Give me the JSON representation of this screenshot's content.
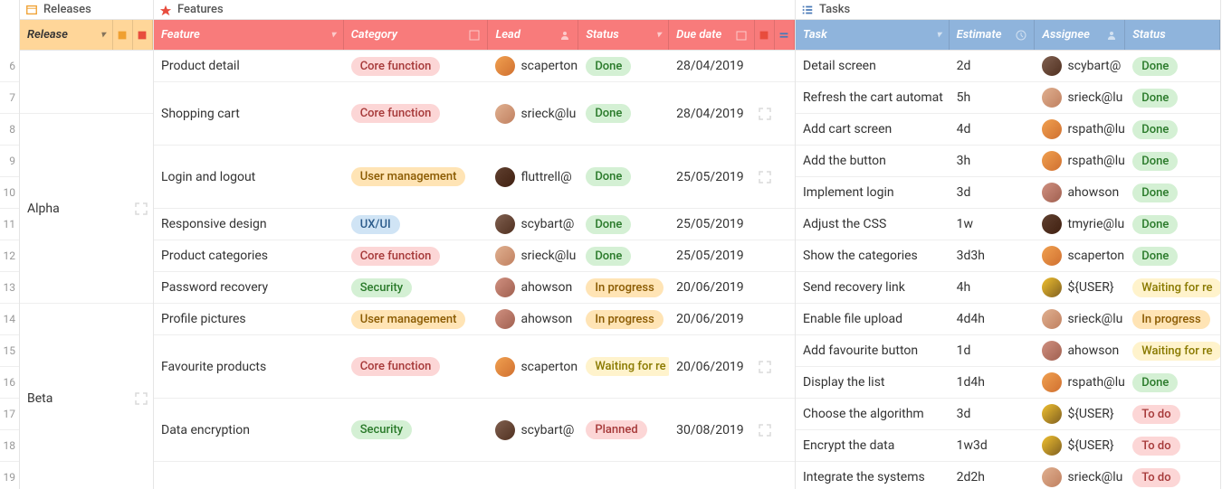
{
  "panels": {
    "releases": {
      "title": "Releases",
      "header": "Release"
    },
    "features": {
      "title": "Features",
      "headers": {
        "feature": "Feature",
        "category": "Category",
        "lead": "Lead",
        "status": "Status",
        "due": "Due date"
      }
    },
    "tasks": {
      "title": "Tasks",
      "headers": {
        "task": "Task",
        "estimate": "Estimate",
        "assignee": "Assignee",
        "status": "Status"
      }
    }
  },
  "row_numbers": [
    "6",
    "7",
    "8",
    "9",
    "10",
    "11",
    "12",
    "13",
    "14",
    "15",
    "16",
    "17",
    "18",
    "19"
  ],
  "releases": [
    {
      "name": "",
      "span": "h2"
    },
    {
      "name": "Alpha",
      "span": "h6"
    },
    {
      "name": "Beta",
      "span": "h6"
    }
  ],
  "features": [
    {
      "name": "Product detail",
      "category": "Core function",
      "cat_class": "badge-core",
      "lead": "scaperton",
      "av": "av1",
      "status": "Done",
      "st_class": "badge-done",
      "due": "28/04/2019",
      "span": ""
    },
    {
      "name": "Shopping cart",
      "category": "Core function",
      "cat_class": "badge-core",
      "lead": "srieck@lu",
      "av": "av2",
      "status": "Done",
      "st_class": "badge-done",
      "due": "28/04/2019",
      "span": "h2"
    },
    {
      "name": "Login and logout",
      "category": "User management",
      "cat_class": "badge-usermgmt",
      "lead": "fluttrell@",
      "av": "av3",
      "status": "Done",
      "st_class": "badge-done",
      "due": "25/05/2019",
      "span": "h2"
    },
    {
      "name": "Responsive design",
      "category": "UX/UI",
      "cat_class": "badge-uxui",
      "lead": "scybart@",
      "av": "av4",
      "status": "Done",
      "st_class": "badge-done",
      "due": "25/05/2019",
      "span": ""
    },
    {
      "name": "Product categories",
      "category": "Core function",
      "cat_class": "badge-core",
      "lead": "srieck@lu",
      "av": "av2",
      "status": "Done",
      "st_class": "badge-done",
      "due": "25/05/2019",
      "span": ""
    },
    {
      "name": "Password recovery",
      "category": "Security",
      "cat_class": "badge-security",
      "lead": "ahowson",
      "av": "av5",
      "status": "In progress",
      "st_class": "badge-inprogress",
      "due": "20/06/2019",
      "span": ""
    },
    {
      "name": "Profile pictures",
      "category": "User management",
      "cat_class": "badge-usermgmt",
      "lead": "ahowson",
      "av": "av5",
      "status": "In progress",
      "st_class": "badge-inprogress",
      "due": "20/06/2019",
      "span": ""
    },
    {
      "name": "Favourite products",
      "category": "Core function",
      "cat_class": "badge-core",
      "lead": "scaperton",
      "av": "av1",
      "status": "Waiting for re",
      "st_class": "badge-waiting",
      "due": "20/06/2019",
      "span": "h2"
    },
    {
      "name": "Data encryption",
      "category": "Security",
      "cat_class": "badge-security",
      "lead": "scybart@",
      "av": "av4",
      "status": "Planned",
      "st_class": "badge-planned",
      "due": "30/08/2019",
      "span": "h2"
    }
  ],
  "tasks": [
    {
      "name": "Detail screen",
      "estimate": "2d",
      "assignee": "scybart@",
      "av": "av4",
      "status": "Done",
      "st_class": "badge-done"
    },
    {
      "name": "Refresh the cart automat",
      "estimate": "5h",
      "assignee": "srieck@lu",
      "av": "av2",
      "status": "Done",
      "st_class": "badge-done"
    },
    {
      "name": "Add cart screen",
      "estimate": "4d",
      "assignee": "rspath@lu",
      "av": "av1",
      "status": "Done",
      "st_class": "badge-done"
    },
    {
      "name": "Add the button",
      "estimate": "3h",
      "assignee": "rspath@lu",
      "av": "av1",
      "status": "Done",
      "st_class": "badge-done"
    },
    {
      "name": "Implement login",
      "estimate": "3d",
      "assignee": "ahowson",
      "av": "av5",
      "status": "Done",
      "st_class": "badge-done"
    },
    {
      "name": "Adjust the CSS",
      "estimate": "1w",
      "assignee": "tmyrie@lu",
      "av": "av3",
      "status": "Done",
      "st_class": "badge-done"
    },
    {
      "name": "Show the categories",
      "estimate": "3d3h",
      "assignee": "scaperton",
      "av": "av1",
      "status": "Done",
      "st_class": "badge-done"
    },
    {
      "name": "Send recovery link",
      "estimate": "4h",
      "assignee": "${USER}",
      "av": "av6",
      "status": "Waiting for re",
      "st_class": "badge-waiting"
    },
    {
      "name": "Enable file upload",
      "estimate": "4d4h",
      "assignee": "srieck@lu",
      "av": "av2",
      "status": "In progress",
      "st_class": "badge-inprogress"
    },
    {
      "name": "Add favourite button",
      "estimate": "1d",
      "assignee": "ahowson",
      "av": "av5",
      "status": "Waiting for re",
      "st_class": "badge-waiting"
    },
    {
      "name": "Display the list",
      "estimate": "1d4h",
      "assignee": "rspath@lu",
      "av": "av1",
      "status": "Done",
      "st_class": "badge-done"
    },
    {
      "name": "Choose the algorithm",
      "estimate": "3d",
      "assignee": "${USER}",
      "av": "av6",
      "status": "To do",
      "st_class": "badge-todo"
    },
    {
      "name": "Encrypt the data",
      "estimate": "1w3d",
      "assignee": "${USER}",
      "av": "av6",
      "status": "To do",
      "st_class": "badge-todo"
    },
    {
      "name": "Integrate the systems",
      "estimate": "2d2h",
      "assignee": "srieck@lu",
      "av": "av2",
      "status": "To do",
      "st_class": "badge-todo"
    }
  ]
}
